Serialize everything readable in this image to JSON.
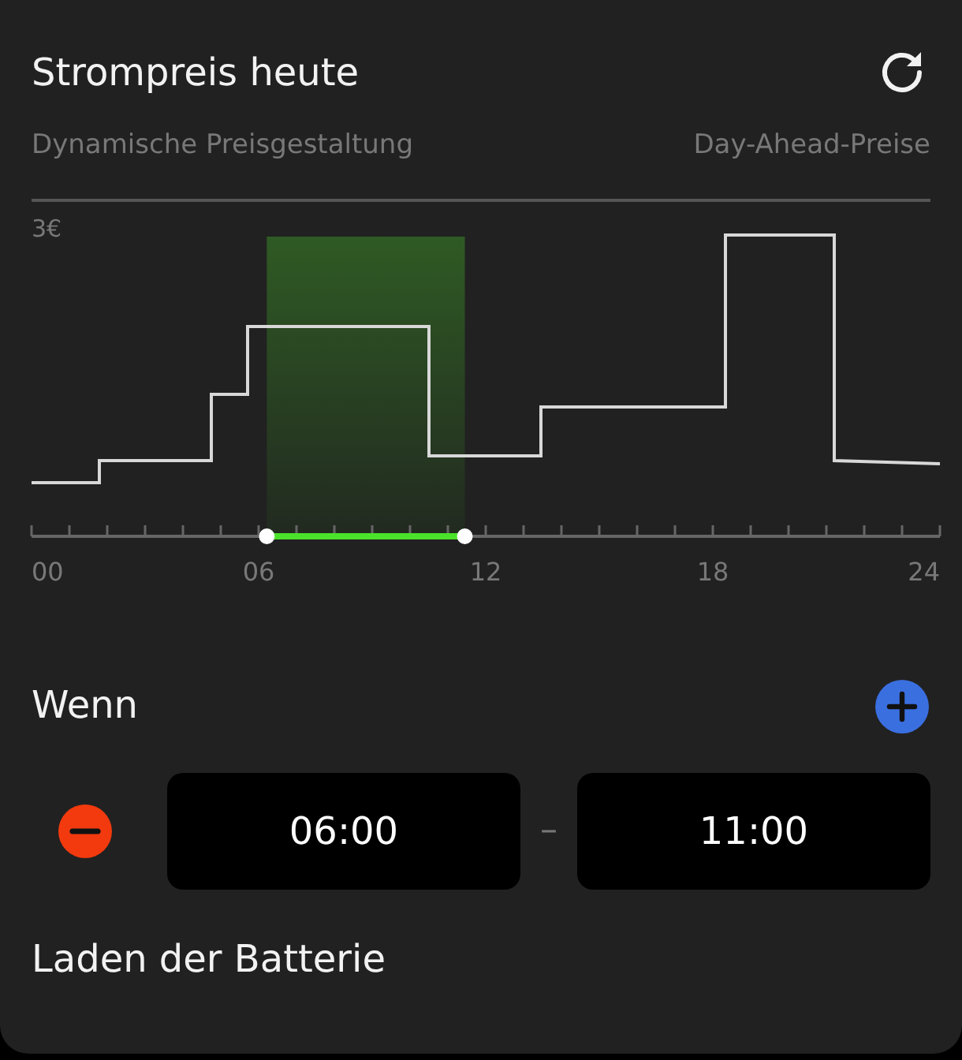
{
  "header": {
    "title": "Strompreis heute",
    "subtitle": "Dynamische Preisgestaltung",
    "source": "Day-Ahead-Preise"
  },
  "chart": {
    "y_label": "3€",
    "x_labels": [
      "00",
      "06",
      "12",
      "18",
      "24"
    ],
    "range_handles": [
      {
        "level": 0.259
      },
      {
        "level": 0.477
      }
    ]
  },
  "condition": {
    "title": "Wenn",
    "ranges": [
      {
        "start": "06:00",
        "separator": "–",
        "end": "11:00"
      }
    ]
  },
  "action": {
    "title": "Laden der Batterie"
  }
}
